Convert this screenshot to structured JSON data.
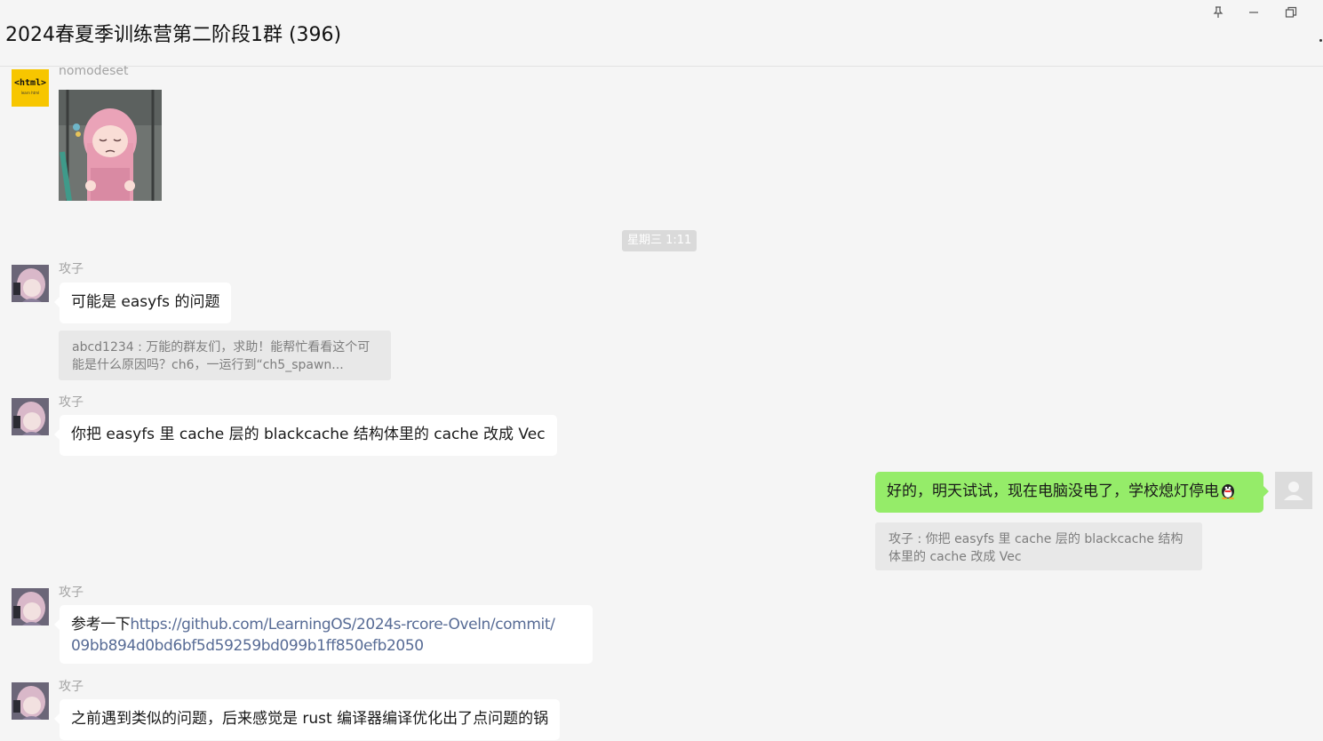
{
  "window": {
    "title": "2024春夏季训练营第二阶段1群 (396)",
    "pin_icon": "pin-icon",
    "minimize_icon": "minimize-icon",
    "restore_icon": "restore-icon"
  },
  "messages": [
    {
      "sender": "nomodeset",
      "type": "image",
      "avatar_text": "<html>",
      "avatar_subtext": "learn html"
    },
    {
      "timestamp": "星期三 1:11"
    },
    {
      "sender": "攻子",
      "text": "可能是 easyfs 的问题",
      "quote": "abcd1234 : 万能的群友们，求助！能帮忙看看这个可能是什么原因吗？ch6，一运行到“ch5_spawn..."
    },
    {
      "sender": "攻子",
      "text": "你把 easyfs 里 cache 层的 blackcache 结构体里的 cache 改成 Vec"
    },
    {
      "self": true,
      "text": "好的，明天试试，现在电脑没电了，学校熄灯停电",
      "quote": "攻子 : 你把 easyfs 里 cache 层的 blackcache 结构体里的 cache 改成 Vec"
    },
    {
      "sender": "攻子",
      "text_prefix": "参考一下",
      "link_line1": "https://github.com/LearningOS/2024s-rcore-Oveln/commit/",
      "link_line2": "09bb894d0bd6bf5d59259bd099b1ff850efb2050"
    },
    {
      "sender": "攻子",
      "text": "之前遇到类似的问题，后来感觉是 rust 编译器编译优化出了点问题的锅"
    }
  ],
  "colors": {
    "background": "#f5f5f5",
    "self_bubble": "#95ec69",
    "other_bubble": "#ffffff",
    "quote_bg": "#e8e8e8",
    "link": "#576b95"
  }
}
